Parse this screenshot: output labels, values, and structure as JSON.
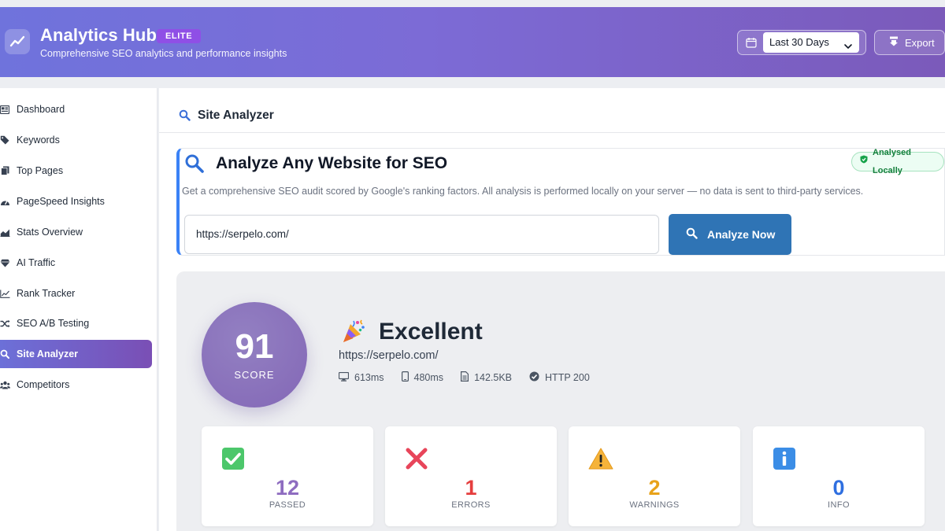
{
  "app": {
    "title": "Analytics Hub",
    "badge": "ELITE",
    "subtitle": "Comprehensive SEO analytics and performance insights",
    "date_range": "Last 30 Days",
    "export_label": "Export"
  },
  "sidebar": {
    "items": [
      {
        "label": "Dashboard",
        "icon": "dashboard-icon"
      },
      {
        "label": "Keywords",
        "icon": "tag-icon"
      },
      {
        "label": "Top Pages",
        "icon": "pages-icon"
      },
      {
        "label": "PageSpeed Insights",
        "icon": "speedometer-icon"
      },
      {
        "label": "Stats Overview",
        "icon": "area-chart-icon"
      },
      {
        "label": "AI Traffic",
        "icon": "diamond-icon"
      },
      {
        "label": "Rank Tracker",
        "icon": "line-chart-icon"
      },
      {
        "label": "SEO A/B Testing",
        "icon": "shuffle-icon"
      },
      {
        "label": "Site Analyzer",
        "icon": "search-icon",
        "active": true
      },
      {
        "label": "Competitors",
        "icon": "users-icon"
      }
    ]
  },
  "page": {
    "title": "Site Analyzer"
  },
  "analyzer": {
    "title": "Analyze Any Website for SEO",
    "badge": "Analysed Locally",
    "description": "Get a comprehensive SEO audit scored by Google's ranking factors. All analysis is performed locally on your server — no data is sent to third-party services.",
    "url_value": "https://serpelo.com/",
    "button_label": "Analyze Now"
  },
  "result": {
    "score": "91",
    "score_label": "SCORE",
    "grade": "Excellent",
    "url": "https://serpelo.com/",
    "metrics": {
      "desktop_time": "613ms",
      "mobile_time": "480ms",
      "page_size": "142.5KB",
      "status": "HTTP 200"
    }
  },
  "stats": [
    {
      "value": "12",
      "label": "PASSED",
      "color": "#8e6cc0",
      "icon": "check-icon"
    },
    {
      "value": "1",
      "label": "ERRORS",
      "color": "#e53e3e",
      "icon": "cross-icon"
    },
    {
      "value": "2",
      "label": "WARNINGS",
      "color": "#e8a21a",
      "icon": "warning-icon"
    },
    {
      "value": "0",
      "label": "INFO",
      "color": "#2f6fe0",
      "icon": "info-icon"
    }
  ],
  "colors": {
    "accent": "#6f73dc",
    "primary_button": "#2f74b5",
    "card_border_accent": "#3b82f6"
  }
}
